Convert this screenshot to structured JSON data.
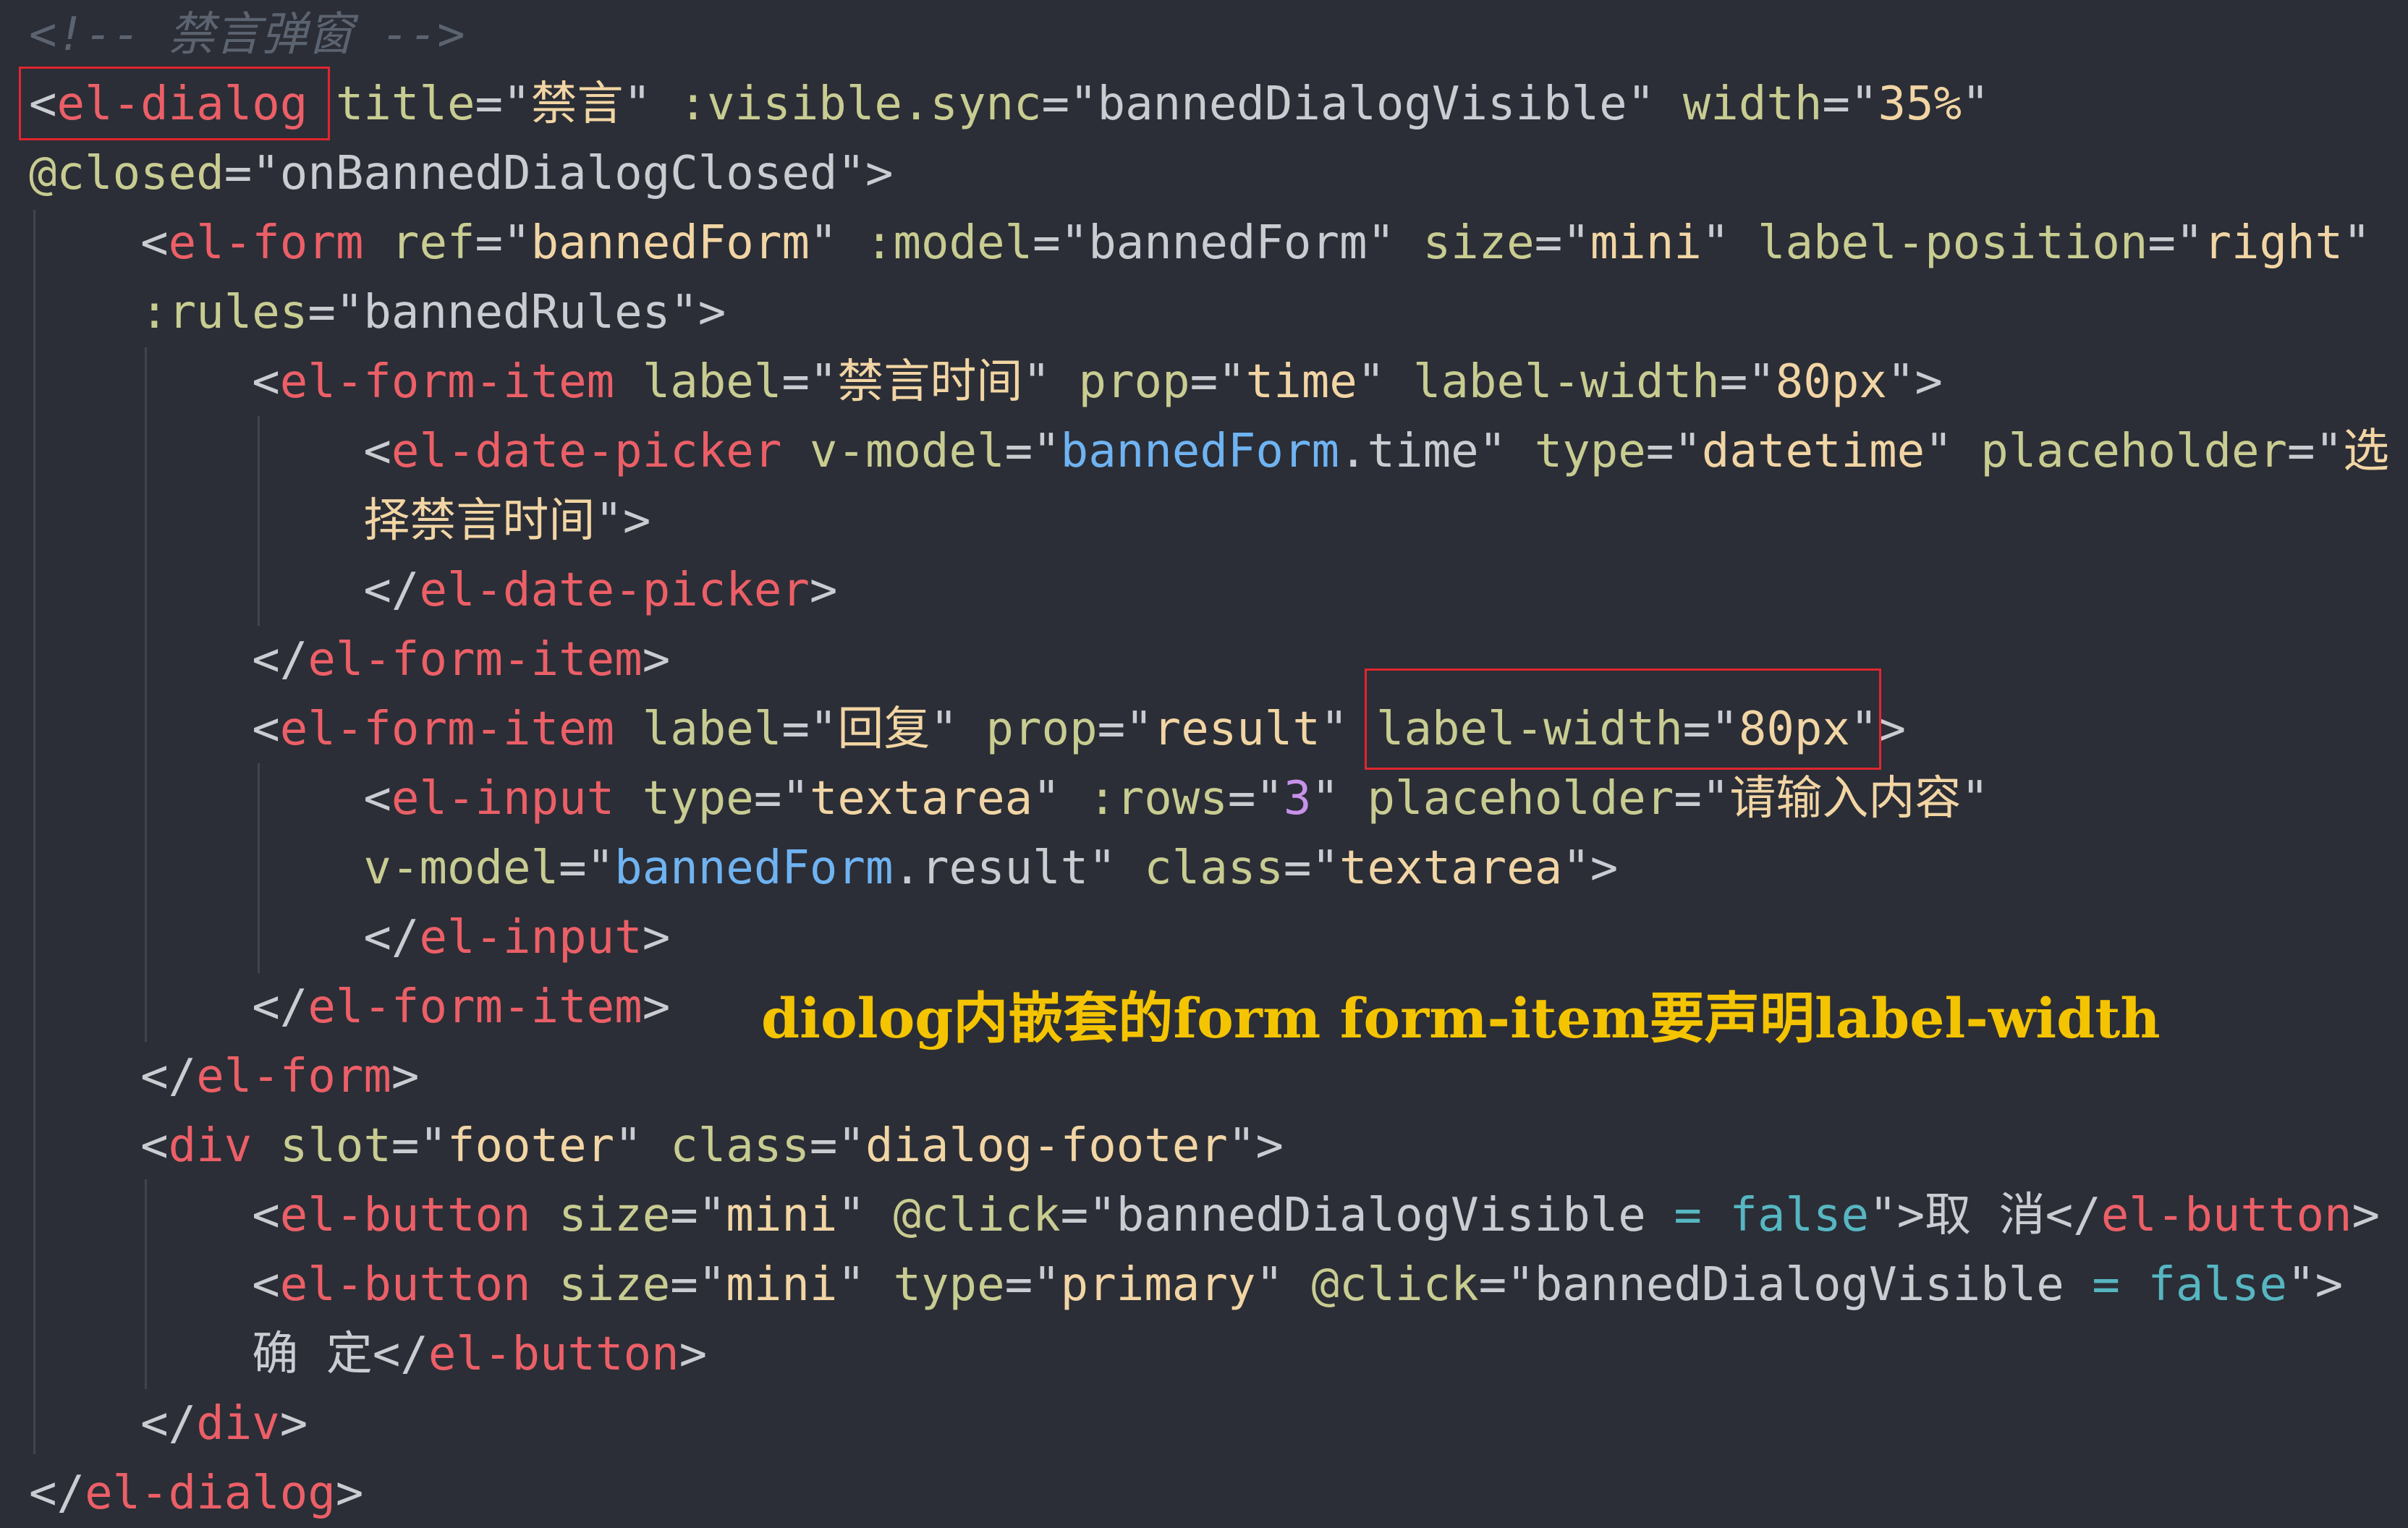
{
  "code_lines": [
    [
      {
        "t": "comment",
        "v": "<!-- 禁言弹窗 -->"
      }
    ],
    [
      {
        "t": "txt",
        "v": "<"
      },
      {
        "t": "tag",
        "v": "el-dialog"
      },
      {
        "t": "txt",
        "v": " "
      },
      {
        "t": "attr",
        "v": "title"
      },
      {
        "t": "txt",
        "v": "=\""
      },
      {
        "t": "str",
        "v": "禁言"
      },
      {
        "t": "txt",
        "v": "\" "
      },
      {
        "t": "attr",
        "v": ":visible.sync"
      },
      {
        "t": "txt",
        "v": "=\"bannedDialogVisible\" "
      },
      {
        "t": "attr",
        "v": "width"
      },
      {
        "t": "txt",
        "v": "=\""
      },
      {
        "t": "str",
        "v": "35%"
      },
      {
        "t": "txt",
        "v": "\""
      }
    ],
    [
      {
        "t": "attr",
        "v": "@closed"
      },
      {
        "t": "txt",
        "v": "=\"onBannedDialogClosed\">"
      }
    ],
    [
      {
        "t": "txt",
        "v": "    <"
      },
      {
        "t": "tag",
        "v": "el-form"
      },
      {
        "t": "txt",
        "v": " "
      },
      {
        "t": "attr",
        "v": "ref"
      },
      {
        "t": "txt",
        "v": "=\""
      },
      {
        "t": "str",
        "v": "bannedForm"
      },
      {
        "t": "txt",
        "v": "\" "
      },
      {
        "t": "attr",
        "v": ":model"
      },
      {
        "t": "txt",
        "v": "=\"bannedForm\" "
      },
      {
        "t": "attr",
        "v": "size"
      },
      {
        "t": "txt",
        "v": "=\""
      },
      {
        "t": "str",
        "v": "mini"
      },
      {
        "t": "txt",
        "v": "\" "
      },
      {
        "t": "attr",
        "v": "label-position"
      },
      {
        "t": "txt",
        "v": "=\""
      },
      {
        "t": "str",
        "v": "right"
      },
      {
        "t": "txt",
        "v": "\""
      }
    ],
    [
      {
        "t": "txt",
        "v": "    "
      },
      {
        "t": "attr",
        "v": ":rules"
      },
      {
        "t": "txt",
        "v": "=\"bannedRules\">"
      }
    ],
    [
      {
        "t": "txt",
        "v": "        <"
      },
      {
        "t": "tag",
        "v": "el-form-item"
      },
      {
        "t": "txt",
        "v": " "
      },
      {
        "t": "attr",
        "v": "label"
      },
      {
        "t": "txt",
        "v": "=\""
      },
      {
        "t": "str",
        "v": "禁言时间"
      },
      {
        "t": "txt",
        "v": "\" "
      },
      {
        "t": "attr",
        "v": "prop"
      },
      {
        "t": "txt",
        "v": "=\""
      },
      {
        "t": "str",
        "v": "time"
      },
      {
        "t": "txt",
        "v": "\" "
      },
      {
        "t": "attr",
        "v": "label-width"
      },
      {
        "t": "txt",
        "v": "=\""
      },
      {
        "t": "str",
        "v": "80px"
      },
      {
        "t": "txt",
        "v": "\">"
      }
    ],
    [
      {
        "t": "txt",
        "v": "            <"
      },
      {
        "t": "tag",
        "v": "el-date-picker"
      },
      {
        "t": "txt",
        "v": " "
      },
      {
        "t": "attr",
        "v": "v-model"
      },
      {
        "t": "txt",
        "v": "=\""
      },
      {
        "t": "var",
        "v": "bannedForm"
      },
      {
        "t": "txt",
        "v": ".time\" "
      },
      {
        "t": "attr",
        "v": "type"
      },
      {
        "t": "txt",
        "v": "=\""
      },
      {
        "t": "str",
        "v": "datetime"
      },
      {
        "t": "txt",
        "v": "\" "
      },
      {
        "t": "attr",
        "v": "placeholder"
      },
      {
        "t": "txt",
        "v": "=\""
      },
      {
        "t": "str",
        "v": "选"
      }
    ],
    [
      {
        "t": "txt",
        "v": "            "
      },
      {
        "t": "str",
        "v": "择禁言时间"
      },
      {
        "t": "txt",
        "v": "\">"
      }
    ],
    [
      {
        "t": "txt",
        "v": "            </"
      },
      {
        "t": "tag",
        "v": "el-date-picker"
      },
      {
        "t": "txt",
        "v": ">"
      }
    ],
    [
      {
        "t": "txt",
        "v": "        </"
      },
      {
        "t": "tag",
        "v": "el-form-item"
      },
      {
        "t": "txt",
        "v": ">"
      }
    ],
    [
      {
        "t": "txt",
        "v": "        <"
      },
      {
        "t": "tag",
        "v": "el-form-item"
      },
      {
        "t": "txt",
        "v": " "
      },
      {
        "t": "attr",
        "v": "label"
      },
      {
        "t": "txt",
        "v": "=\""
      },
      {
        "t": "str",
        "v": "回复"
      },
      {
        "t": "txt",
        "v": "\" "
      },
      {
        "t": "attr",
        "v": "prop"
      },
      {
        "t": "txt",
        "v": "=\""
      },
      {
        "t": "str",
        "v": "result"
      },
      {
        "t": "txt",
        "v": "\" "
      },
      {
        "t": "attr",
        "v": "label-width"
      },
      {
        "t": "txt",
        "v": "=\""
      },
      {
        "t": "str",
        "v": "80px"
      },
      {
        "t": "txt",
        "v": "\">"
      }
    ],
    [
      {
        "t": "txt",
        "v": "            <"
      },
      {
        "t": "tag",
        "v": "el-input"
      },
      {
        "t": "txt",
        "v": " "
      },
      {
        "t": "attr",
        "v": "type"
      },
      {
        "t": "txt",
        "v": "=\""
      },
      {
        "t": "str",
        "v": "textarea"
      },
      {
        "t": "txt",
        "v": "\" "
      },
      {
        "t": "attr",
        "v": ":rows"
      },
      {
        "t": "txt",
        "v": "=\""
      },
      {
        "t": "num",
        "v": "3"
      },
      {
        "t": "txt",
        "v": "\" "
      },
      {
        "t": "attr",
        "v": "placeholder"
      },
      {
        "t": "txt",
        "v": "=\""
      },
      {
        "t": "str",
        "v": "请输入内容"
      },
      {
        "t": "txt",
        "v": "\""
      }
    ],
    [
      {
        "t": "txt",
        "v": "            "
      },
      {
        "t": "attr",
        "v": "v-model"
      },
      {
        "t": "txt",
        "v": "=\""
      },
      {
        "t": "var",
        "v": "bannedForm"
      },
      {
        "t": "txt",
        "v": ".result\" "
      },
      {
        "t": "attr",
        "v": "class"
      },
      {
        "t": "txt",
        "v": "=\""
      },
      {
        "t": "str",
        "v": "textarea"
      },
      {
        "t": "txt",
        "v": "\">"
      }
    ],
    [
      {
        "t": "txt",
        "v": "            </"
      },
      {
        "t": "tag",
        "v": "el-input"
      },
      {
        "t": "txt",
        "v": ">"
      }
    ],
    [
      {
        "t": "txt",
        "v": "        </"
      },
      {
        "t": "tag",
        "v": "el-form-item"
      },
      {
        "t": "txt",
        "v": ">"
      }
    ],
    [
      {
        "t": "txt",
        "v": "    </"
      },
      {
        "t": "tag",
        "v": "el-form"
      },
      {
        "t": "txt",
        "v": ">"
      }
    ],
    [
      {
        "t": "txt",
        "v": "    <"
      },
      {
        "t": "tag",
        "v": "div"
      },
      {
        "t": "txt",
        "v": " "
      },
      {
        "t": "attr",
        "v": "slot"
      },
      {
        "t": "txt",
        "v": "=\""
      },
      {
        "t": "str",
        "v": "footer"
      },
      {
        "t": "txt",
        "v": "\" "
      },
      {
        "t": "attr",
        "v": "class"
      },
      {
        "t": "txt",
        "v": "=\""
      },
      {
        "t": "str",
        "v": "dialog-footer"
      },
      {
        "t": "txt",
        "v": "\">"
      }
    ],
    [
      {
        "t": "txt",
        "v": "        <"
      },
      {
        "t": "tag",
        "v": "el-button"
      },
      {
        "t": "txt",
        "v": " "
      },
      {
        "t": "attr",
        "v": "size"
      },
      {
        "t": "txt",
        "v": "=\""
      },
      {
        "t": "str",
        "v": "mini"
      },
      {
        "t": "txt",
        "v": "\" "
      },
      {
        "t": "attr",
        "v": "@click"
      },
      {
        "t": "txt",
        "v": "=\"bannedDialogVisible "
      },
      {
        "t": "op",
        "v": "="
      },
      {
        "t": "txt",
        "v": " "
      },
      {
        "t": "kw",
        "v": "false"
      },
      {
        "t": "txt",
        "v": "\">取 消</"
      },
      {
        "t": "tag",
        "v": "el-button"
      },
      {
        "t": "txt",
        "v": ">"
      }
    ],
    [
      {
        "t": "txt",
        "v": "        <"
      },
      {
        "t": "tag",
        "v": "el-button"
      },
      {
        "t": "txt",
        "v": " "
      },
      {
        "t": "attr",
        "v": "size"
      },
      {
        "t": "txt",
        "v": "=\""
      },
      {
        "t": "str",
        "v": "mini"
      },
      {
        "t": "txt",
        "v": "\" "
      },
      {
        "t": "attr",
        "v": "type"
      },
      {
        "t": "txt",
        "v": "=\""
      },
      {
        "t": "str",
        "v": "primary"
      },
      {
        "t": "txt",
        "v": "\" "
      },
      {
        "t": "attr",
        "v": "@click"
      },
      {
        "t": "txt",
        "v": "=\"bannedDialogVisible "
      },
      {
        "t": "op",
        "v": "="
      },
      {
        "t": "txt",
        "v": " "
      },
      {
        "t": "kw",
        "v": "false"
      },
      {
        "t": "txt",
        "v": "\">"
      }
    ],
    [
      {
        "t": "txt",
        "v": "        确 定</"
      },
      {
        "t": "tag",
        "v": "el-button"
      },
      {
        "t": "txt",
        "v": ">"
      }
    ],
    [
      {
        "t": "txt",
        "v": "    </"
      },
      {
        "t": "tag",
        "v": "div"
      },
      {
        "t": "txt",
        "v": ">"
      }
    ],
    [
      {
        "t": "txt",
        "v": "</"
      },
      {
        "t": "tag",
        "v": "el-dialog"
      },
      {
        "t": "txt",
        "v": ">"
      }
    ]
  ],
  "annotation": "diolog内嵌套的form form-item要声明label-width",
  "colors": {
    "background": "#2b2e36",
    "tag": "#ec5f67",
    "attribute": "#c8cc91",
    "string": "#f2d5a4",
    "variable": "#6fb3f2",
    "number": "#c792ea",
    "keyword": "#56b6c2",
    "comment": "#5c6370",
    "highlight_box": "#e0262f",
    "annotation": "#f5c400"
  }
}
